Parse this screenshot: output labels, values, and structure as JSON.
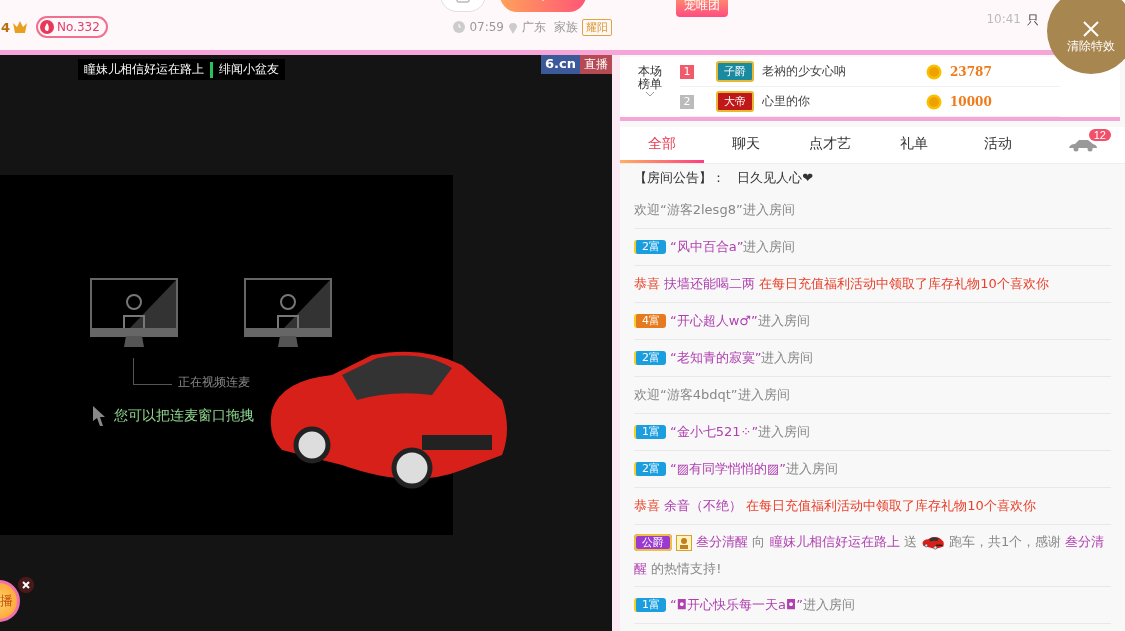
{
  "header": {
    "level": "4",
    "rank_badge": "No.332",
    "time": "07:59",
    "location": "广东",
    "family_label": "家族",
    "family_badge": "耀阳",
    "fan_badge": "宠唯团",
    "recent_times": [
      "10:41"
    ],
    "recent_text": "只"
  },
  "clear_effects": {
    "label": "清除特效"
  },
  "video": {
    "anchors": [
      "瞳妹儿相信好运在路上",
      "绯闻小盆友"
    ],
    "logo": "6.cn",
    "logo_tag": "直播",
    "link_status": "正在视频连麦",
    "drag_hint": "您可以把连麦窗口拖拽",
    "float_button": "播"
  },
  "rank": {
    "title": [
      "本场",
      "榜单"
    ],
    "rows": [
      {
        "rank": "1",
        "title": "子爵",
        "kind": "viscount",
        "name": "老衲的少女心呐",
        "score": "23787"
      },
      {
        "rank": "2",
        "title": "大帝",
        "kind": "emperor",
        "name": "心里的你",
        "score": "10000"
      }
    ]
  },
  "tabs": [
    {
      "label": "全部",
      "selected": true
    },
    {
      "label": "聊天",
      "selected": false
    },
    {
      "label": "点才艺",
      "selected": false
    },
    {
      "label": "礼单",
      "selected": false
    },
    {
      "label": "活动",
      "selected": false
    }
  ],
  "car_count": "12",
  "chat": [
    {
      "kind": "notice",
      "label": "【房间公告】：",
      "text": "日久见人心❤"
    },
    {
      "kind": "welcome",
      "text": "欢迎“游客2lesg8”进入房间"
    },
    {
      "kind": "enter",
      "badge": "2富",
      "color": "#1a9ee0",
      "name": "“风中百合a”",
      "suffix": "进入房间"
    },
    {
      "kind": "congrats",
      "lead": "恭喜",
      "name": "扶墙还能喝二两",
      "text": "在每日充值福利活动中领取了库存礼物10个喜欢你"
    },
    {
      "kind": "enter",
      "badge": "4富",
      "color": "#e57a1e",
      "name": "“开心超人w♂”",
      "suffix": "进入房间"
    },
    {
      "kind": "enter",
      "badge": "2富",
      "color": "#1a9ee0",
      "name": "“老知青的寂寞”",
      "suffix": "进入房间"
    },
    {
      "kind": "welcome",
      "text": "欢迎“游客4bdqt”进入房间"
    },
    {
      "kind": "enter",
      "badge": "1富",
      "color": "#1a9ee0",
      "name": "“金小七521⁘”",
      "suffix": "进入房间"
    },
    {
      "kind": "enter",
      "badge": "2富",
      "color": "#1a9ee0",
      "name": "“▨有同学悄悄的▨”",
      "suffix": "进入房间"
    },
    {
      "kind": "congrats",
      "lead": "恭喜",
      "name": "余音（不绝）",
      "text": "在每日充值福利活动中领取了库存礼物10个喜欢你"
    },
    {
      "kind": "gift",
      "badge": "公爵",
      "sender": "叁分清醒",
      "to": "向",
      "receiver": "瞳妹儿相信好运在路上",
      "send": "送",
      "gift": "跑车，共1个，感谢",
      "thanked": "叁分清醒",
      "tail": "的热情支持!"
    },
    {
      "kind": "enter",
      "badge": "1富",
      "color": "#1a9ee0",
      "name": "“◘开心快乐每一天a◘”",
      "suffix": "进入房间"
    }
  ]
}
